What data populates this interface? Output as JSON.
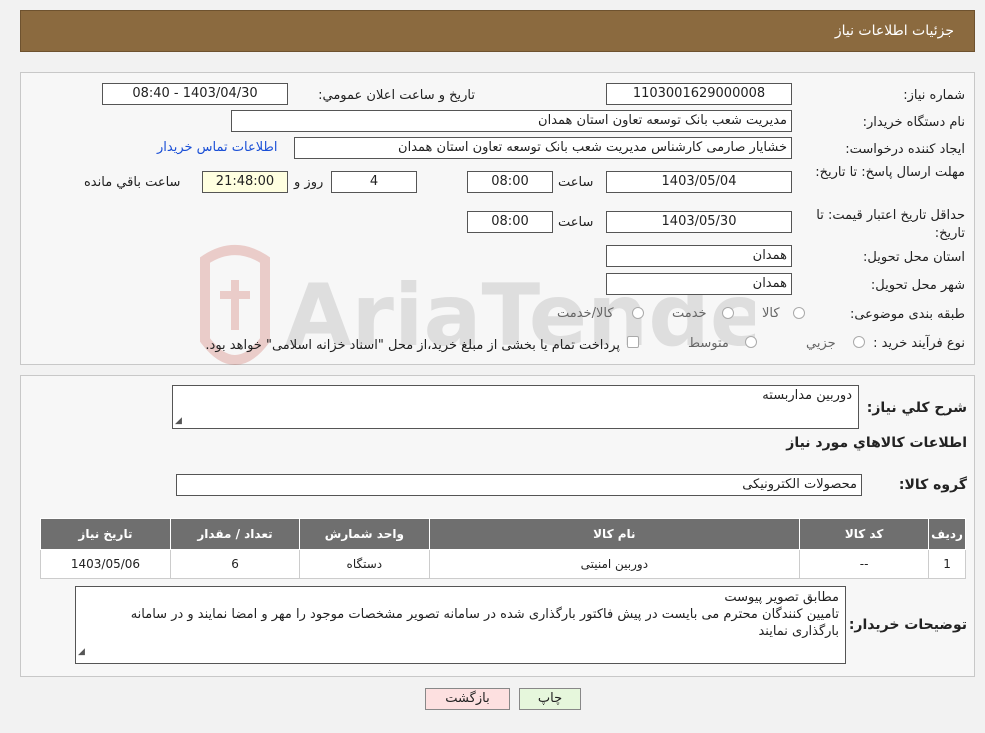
{
  "header": {
    "title": "جزئیات اطلاعات نیاز"
  },
  "info": {
    "need_number_label": "شماره نیاز:",
    "need_number": "1103001629000008",
    "announce_label": "تاریخ و ساعت اعلان عمومي:",
    "announce_value": "1403/04/30 - 08:40",
    "buyer_label": "نام دستگاه خریدار:",
    "buyer_value": "مدیریت شعب بانک توسعه تعاون استان همدان",
    "creator_label": "ایجاد کننده درخواست:",
    "creator_value": "خشایار صارمی کارشناس مدیریت شعب بانک توسعه تعاون استان همدان",
    "contact_link": "اطلاعات تماس خریدار",
    "deadline_label": "مهلت ارسال پاسخ: تا تاریخ:",
    "deadline_date": "1403/05/04",
    "time_label": "ساعت",
    "deadline_time": "08:00",
    "days_value": "4",
    "days_label": "روز و",
    "remaining_time": "21:48:00",
    "remaining_label": "ساعت باقي مانده",
    "validity_label": "حداقل تاریخ اعتبار قیمت: تا تاریخ:",
    "validity_date": "1403/05/30",
    "validity_time": "08:00",
    "province_label": "استان محل تحویل:",
    "province_value": "همدان",
    "city_label": "شهر محل تحویل:",
    "city_value": "همدان",
    "category_label": "طبقه بندی موضوعی:",
    "category_options": [
      "کالا",
      "خدمت",
      "کالا/خدمت"
    ],
    "process_label": "نوع فرآیند خرید :",
    "process_options": [
      "جزيي",
      "متوسط"
    ],
    "process_note": "پرداخت تمام یا بخشی از مبلغ خرید،از محل \"اسناد خزانه اسلامی\" خواهد بود."
  },
  "watermark_text": "AriaTender.neT",
  "description": {
    "general_label": "شرح کلي نیاز:",
    "general_value": "دوربین مداربسته",
    "goods_info_title": "اطلاعات کالاهاي مورد نیاز",
    "group_label": "گروه کالا:",
    "group_value": "محصولات الکترونیکی"
  },
  "table": {
    "headers": [
      "ردیف",
      "کد کالا",
      "نام کالا",
      "واحد شمارش",
      "تعداد / مقدار",
      "تاریخ نیاز"
    ],
    "rows": [
      [
        "1",
        "--",
        "دوربین امنیتی",
        "دستگاه",
        "6",
        "1403/05/06"
      ]
    ]
  },
  "buyer_notes": {
    "label": "توضیحات خریدار:",
    "line1": "مطابق تصویر پیوست",
    "line2": "تامیین کنندگان محترم می بایست در پیش فاکتور بارگذاری شده در سامانه تصویر مشخصات موجود را مهر و امضا نمایند و در سامانه بارگذاری نمایند"
  },
  "buttons": {
    "print": "چاپ",
    "back": "بازگشت"
  },
  "colors": {
    "header_bg": "#8b6a3f",
    "table_header_bg": "#6f6f6f",
    "remaining_bg": "#ffffe0",
    "link": "#1a4fd6",
    "back_bg": "#fde0e0",
    "print_bg": "#e6f7dc"
  }
}
